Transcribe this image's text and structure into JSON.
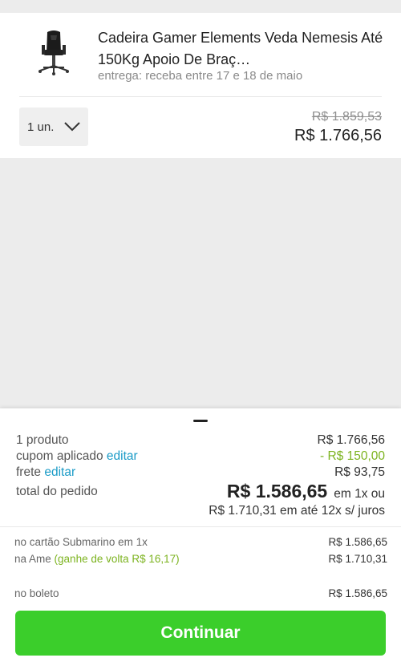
{
  "product": {
    "title": "Cadeira Gamer Elements Veda Nemesis Até 150Kg Apoio De Braç…",
    "delivery": "entrega: receba entre 17 e 18 de maio",
    "quantity": "1 un.",
    "price_old": "R$ 1.859,53",
    "price_new": "R$ 1.766,56"
  },
  "summary": {
    "products_label": "1 produto",
    "products_value": "R$ 1.766,56",
    "coupon_label": "cupom aplicado",
    "coupon_edit": "editar",
    "coupon_value": "- R$ 150,00",
    "shipping_label": "frete",
    "shipping_edit": "editar",
    "shipping_value": "R$ 93,75",
    "total_label": "total do pedido",
    "total_value": "R$ 1.586,65",
    "total_suffix": "em 1x ou",
    "installments": "R$ 1.710,31 em até 12x s/ juros"
  },
  "payment_options": [
    {
      "label": "no cartão Submarino em 1x",
      "value": "R$ 1.586,65"
    },
    {
      "label": "na Ame",
      "cashback": "(ganhe de volta R$ 16,17)",
      "value": "R$ 1.710,31"
    },
    {
      "label": "no boleto",
      "value": "R$ 1.586,65"
    }
  ],
  "cta": {
    "label": "Continuar"
  },
  "colors": {
    "accent_green": "#3bce2b",
    "link_blue": "#1a9bc7",
    "discount_green": "#7cb31f"
  },
  "icons": {
    "thumbnail": "gaming-chair-image",
    "quantity_dropdown": "chevron-down-icon"
  }
}
